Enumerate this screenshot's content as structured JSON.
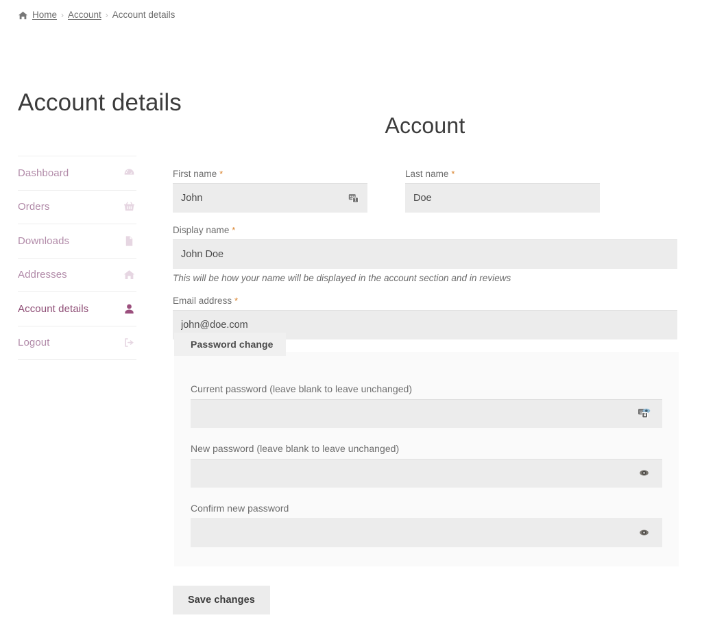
{
  "breadcrumb": {
    "home_icon": "home-icon",
    "items": [
      {
        "label": "Home",
        "link": true
      },
      {
        "label": "Account",
        "link": true
      },
      {
        "label": "Account details",
        "link": false
      }
    ],
    "separator": "›"
  },
  "page": {
    "title": "Account details"
  },
  "sidebar": {
    "items": [
      {
        "label": "Dashboard",
        "icon": "tachometer-icon",
        "active": false
      },
      {
        "label": "Orders",
        "icon": "basket-icon",
        "active": false
      },
      {
        "label": "Downloads",
        "icon": "file-icon",
        "active": false
      },
      {
        "label": "Addresses",
        "icon": "home-icon",
        "active": false
      },
      {
        "label": "Account details",
        "icon": "user-icon",
        "active": true
      },
      {
        "label": "Logout",
        "icon": "sign-out-icon",
        "active": false
      }
    ]
  },
  "form": {
    "heading": "Account",
    "required_marker": "*",
    "first_name": {
      "label": "First name",
      "required": true,
      "value": "John",
      "placeholder": "",
      "icon": "password-manager-icon"
    },
    "last_name": {
      "label": "Last name",
      "required": true,
      "value": "Doe",
      "placeholder": ""
    },
    "display_name": {
      "label": "Display name",
      "required": true,
      "value": "John Doe",
      "placeholder": "",
      "help": "This will be how your name will be displayed in the account section and in reviews"
    },
    "email": {
      "label": "Email address",
      "required": true,
      "value": "john@doe.com",
      "placeholder": ""
    },
    "password_change": {
      "legend": "Password change",
      "current_password": {
        "label": "Current password (leave blank to leave unchanged)",
        "value": "",
        "placeholder": "",
        "icon": "password-manager-eye-icon"
      },
      "new_password": {
        "label": "New password (leave blank to leave unchanged)",
        "value": "",
        "placeholder": "",
        "icon": "eye-icon"
      },
      "confirm_password": {
        "label": "Confirm new password",
        "value": "",
        "placeholder": "",
        "icon": "eye-icon"
      }
    },
    "save_label": "Save changes"
  },
  "colors": {
    "accent": "#9b4f7d",
    "accent_muted": "#b18aa8",
    "required": "#d9822b",
    "input_bg": "#ececec",
    "fieldset_bg": "#fafafa",
    "text": "#4a4a4a"
  }
}
